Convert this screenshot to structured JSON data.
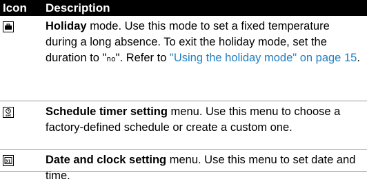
{
  "header": {
    "icon_col": "Icon",
    "desc_col": "Description"
  },
  "rows": [
    {
      "icon": "suitcase-icon",
      "title": "Holiday",
      "text_before": " mode. Use this mode to set a fixed temperature during a long absence. To exit the holiday mode, set the duration to \"",
      "lcd_value": "no",
      "text_mid": "\". Refer to ",
      "link": "\"Using the holiday mode\" on page 15",
      "text_after": "."
    },
    {
      "icon": "clock-set-icon",
      "title": "Schedule timer setting",
      "text": " menu. Use this menu to choose a factory-defined schedule or create a custom one."
    },
    {
      "icon": "calendar-icon",
      "title": "Date and clock setting",
      "text": " menu. Use this menu to set date and time."
    }
  ],
  "icon_texts": {
    "set": "set",
    "cal": "31"
  },
  "colors": {
    "header_bg": "#000000",
    "header_fg": "#ffffff",
    "link": "#1f7fc0",
    "row_border": "#9a9a9a"
  }
}
